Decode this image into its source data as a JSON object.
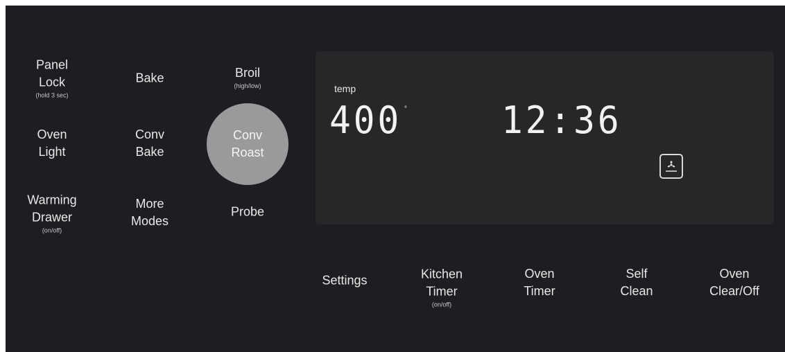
{
  "left_keys": [
    {
      "lines": [
        "Panel",
        "Lock"
      ],
      "sub": "(hold 3 sec)"
    },
    {
      "lines": [
        "Bake"
      ],
      "sub": ""
    },
    {
      "lines": [
        "Broil"
      ],
      "sub": "(high/low)"
    },
    {
      "lines": [
        "Oven",
        "Light"
      ],
      "sub": ""
    },
    {
      "lines": [
        "Conv",
        "Bake"
      ],
      "sub": ""
    },
    {
      "lines": [
        "Conv",
        "Roast"
      ],
      "sub": "",
      "selected": true
    },
    {
      "lines": [
        "Warming",
        "Drawer"
      ],
      "sub": "(on/off)"
    },
    {
      "lines": [
        "More",
        "Modes"
      ],
      "sub": ""
    },
    {
      "lines": [
        "Probe"
      ],
      "sub": ""
    }
  ],
  "display": {
    "temp_label": "temp",
    "temperature": "400",
    "degree_symbol": "°",
    "clock": "12:36",
    "convection_icon": "convection-fan-icon"
  },
  "bottom_keys": [
    {
      "lines": [
        "Settings"
      ],
      "sub": ""
    },
    {
      "lines": [
        "Kitchen",
        "Timer"
      ],
      "sub": "(on/off)"
    },
    {
      "lines": [
        "Oven",
        "Timer"
      ],
      "sub": ""
    },
    {
      "lines": [
        "Self",
        "Clean"
      ],
      "sub": ""
    },
    {
      "lines": [
        "Oven",
        "Clear/Off"
      ],
      "sub": ""
    }
  ],
  "colors": {
    "panel": "#1d1e21",
    "display": "#262729",
    "selected_key": "#999a9c",
    "text": "#e8e8e8"
  }
}
